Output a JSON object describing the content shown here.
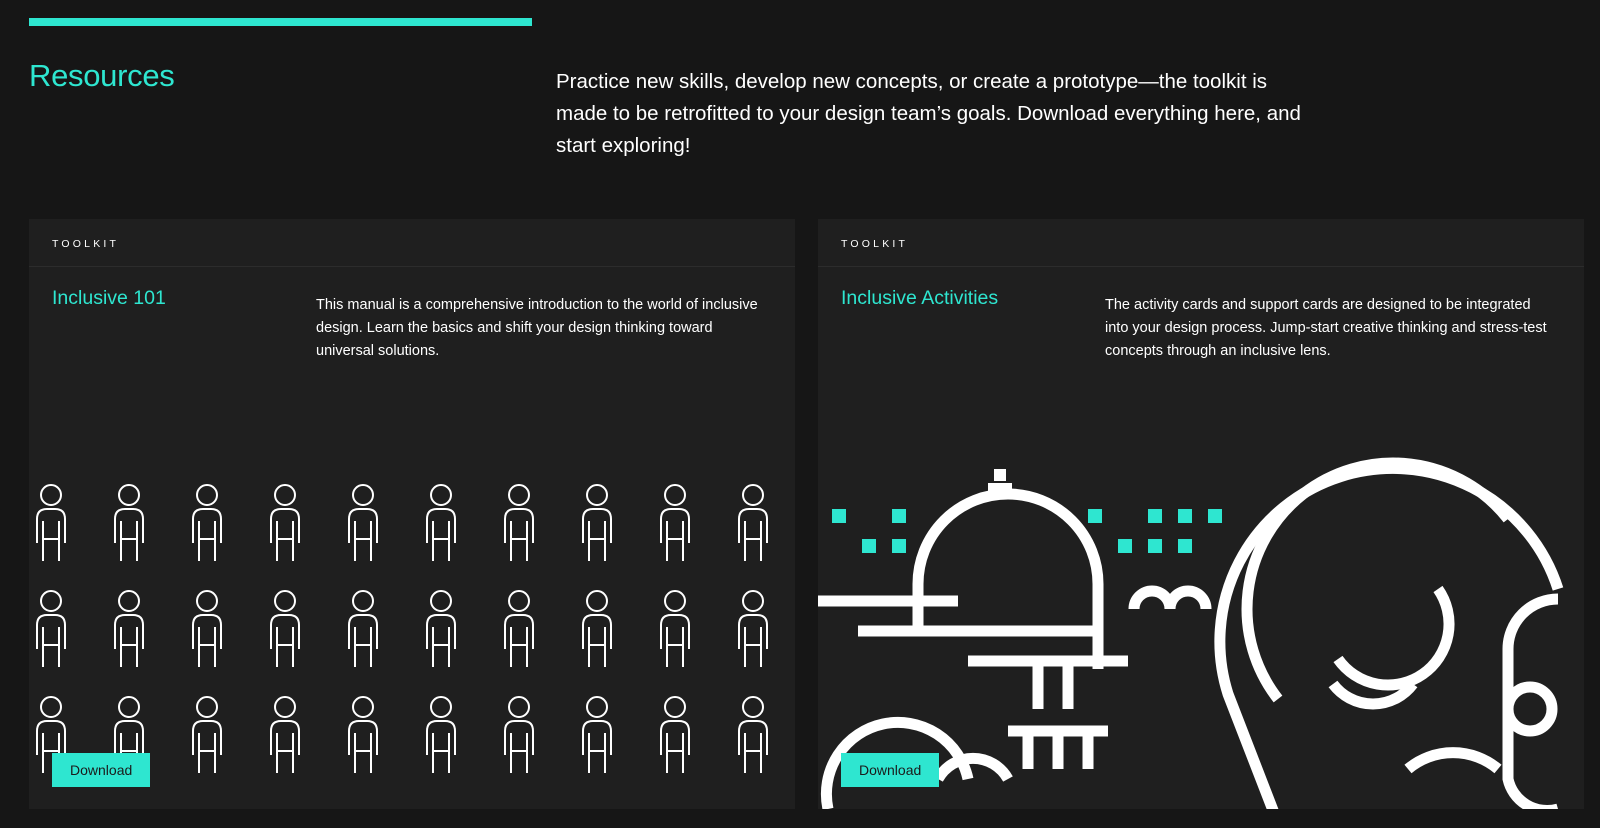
{
  "header": {
    "title": "Resources",
    "intro": "Practice new skills, develop new concepts, or create a prototype—the toolkit is made to be retrofitted to your design team’s goals. Download everything here, and start exploring!"
  },
  "colors": {
    "accent": "#2ee6d0",
    "background": "#161616",
    "card": "#1f1f1f"
  },
  "cards": [
    {
      "eyebrow": "TOOLKIT",
      "title": "Inclusive 101",
      "description": "This manual is a comprehensive introduction to the world of inclusive design. Learn the basics and shift your design thinking toward universal solutions.",
      "button": "Download",
      "art_icon": "people-figures-illustration"
    },
    {
      "eyebrow": "TOOLKIT",
      "title": "Inclusive Activities",
      "description": "The activity cards and support cards are designed to be integrated into your design process. Jump-start creative thinking and stress-test concepts through an inclusive lens.",
      "button": "Download",
      "art_icon": "abstract-line-illustration"
    }
  ]
}
